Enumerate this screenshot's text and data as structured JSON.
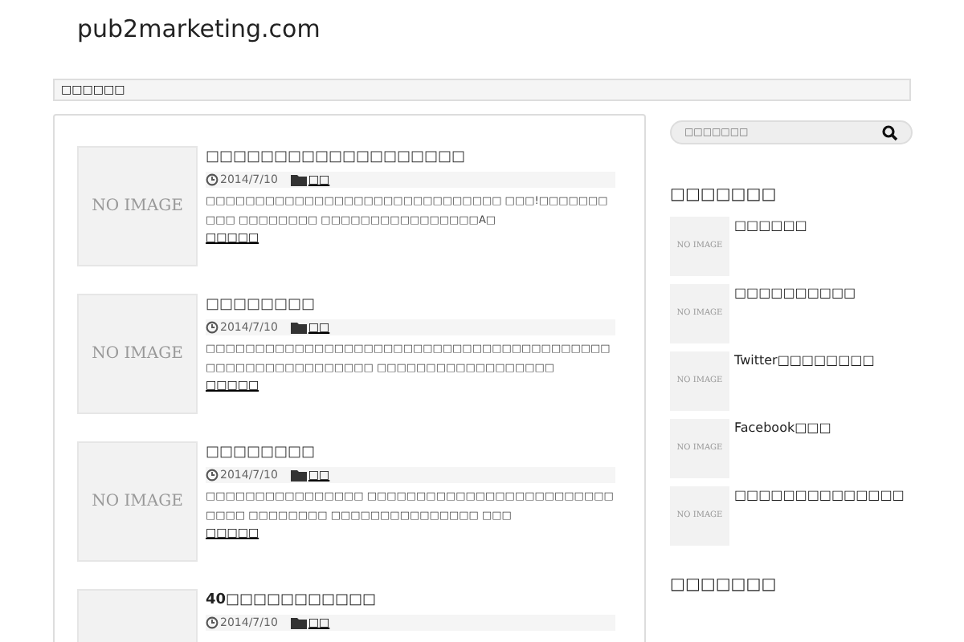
{
  "site": {
    "title": "pub2marketing.com"
  },
  "breadcrumb": "□□□□□□",
  "posts": [
    {
      "thumbnail": "NO IMAGE",
      "title": "□□□□□□□□□□□□□□□□□□□",
      "date": "2014/7/10",
      "category": "□□",
      "excerpt": "□□□□□□□□□□□□□□□□□□□□□□□□□□□□□□ □□□!□□□□□□□□□□ □□□□□□□□ □□□□□□□□□□□□□□□□A□",
      "more": "□□□□□",
      "bold": false
    },
    {
      "thumbnail": "NO IMAGE",
      "title": "□□□□□□□□",
      "date": "2014/7/10",
      "category": "□□",
      "excerpt": "□□□□□□□□□□□□□□□□□□□□□□□□□□□□□□□□□□□□□□□□□□□□□□□□□□□□□□□□□□ □□□□□□□□□□□□□□□□□□",
      "more": "□□□□□",
      "bold": false
    },
    {
      "thumbnail": "NO IMAGE",
      "title": "□□□□□□□□",
      "date": "2014/7/10",
      "category": "□□",
      "excerpt": "□□□□□□□□□□□□□□□□ □□□□□□□□□□□□□□□□□□□□□□□□□□□□□ □□□□□□□□ □□□□□□□□□□□□□□□ □□□",
      "more": "□□□□□",
      "bold": false
    },
    {
      "title": "40□□□□□□□□□□□",
      "date": "2014/7/10",
      "category": "□□",
      "bold": true
    }
  ],
  "sidebar": {
    "search": {
      "placeholder": "□□□□□□□"
    },
    "heading": "□□□□□□□",
    "items": [
      {
        "thumbnail": "NO IMAGE",
        "title": "□□□□□□"
      },
      {
        "thumbnail": "NO IMAGE",
        "title": "□□□□□□□□□□"
      },
      {
        "thumbnail": "NO IMAGE",
        "title": "Twitter□□□□□□□□"
      },
      {
        "thumbnail": "NO IMAGE",
        "title": "Facebook□□□"
      },
      {
        "thumbnail": "NO IMAGE",
        "title": "□□□□□□□□□□□□□□"
      }
    ],
    "heading_2": "□□□□□□□"
  }
}
